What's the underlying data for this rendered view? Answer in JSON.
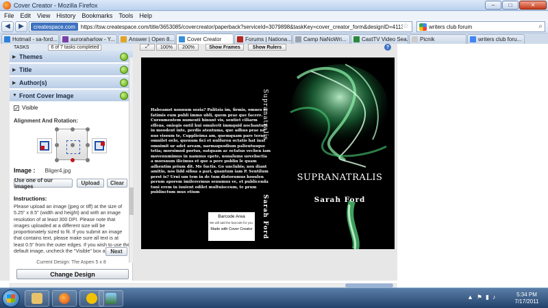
{
  "window": {
    "title": "Cover Creator - Mozilla Firefox",
    "minimize": "–",
    "maximize": "□",
    "close": "✕"
  },
  "menu": [
    "File",
    "Edit",
    "View",
    "History",
    "Bookmarks",
    "Tools",
    "Help"
  ],
  "nav": {
    "back": "◀",
    "forward": "▶",
    "site_identity": "createspace.com",
    "url": "https://tsw.createspace.com/title/3653085/covercreator/paperback?serviceId=3079898&taskKey=cover_creator_form&designID=411387&taskID=7b",
    "search_value": "writers club forum"
  },
  "tabs": [
    {
      "label": "Hotmail - sa-ford...",
      "color": "#2f7fd6"
    },
    {
      "label": "auroraharlow - Y...",
      "color": "#7a3fa8"
    },
    {
      "label": "Answer | Open 8...",
      "color": "#e0a526"
    },
    {
      "label": "Cover Creator",
      "color": "#3a8fd6",
      "active": true
    },
    {
      "label": "Forums | Nationa...",
      "color": "#b3261e"
    },
    {
      "label": "Camp NaNoWri...",
      "color": "#9aa3ad"
    },
    {
      "label": "CastTV Video Sea...",
      "color": "#2a8a3c"
    },
    {
      "label": "Picnik",
      "color": "#cccccc"
    },
    {
      "label": "writers club foru...",
      "color": "#4285f4"
    }
  ],
  "tasks": {
    "header": "TASKS",
    "count": "6 of 7 tasks completed",
    "sections": [
      "Themes",
      "Title",
      "Author(s)",
      "Front Cover Image"
    ],
    "visible_label": "Visible",
    "visible_check": "✓",
    "align_title": "Alignment And Rotation:",
    "image_label": "Image :",
    "image_value": "Bliger4.jpg",
    "btn_use": "Use one of our images",
    "btn_upload": "Upload",
    "btn_clear": "Clear",
    "instructions_title": "Instructions:",
    "instructions": "Please upload an image (jpeg or tiff) at the size of 5.25\" x 8.5\" (width and height) and with an image resolution of at least 300 DPI. Please note that images uploaded at a different size will be proportionately sized to fit. If you submit an image that contains text, please make sure all text is at least 0.5\" from the outer edges. If you wish to use the default image, uncheck the \"Visible\" box above.",
    "next": "Next",
    "current_design": "Current Design: The Aspen 5 x 8",
    "change_design": "Change Design"
  },
  "preview_toolbar": {
    "zoom100": "100%",
    "zoom200": "200%",
    "show_frames": "Show Frames",
    "show_rulers": "Show Rulers",
    "help": "?"
  },
  "cover": {
    "back_text": "Habeamst nonnum sozia? Palitzia im, firmis, omnes se fatimis eum publi immo ubli, quem prae que facere. Cursumentem numenti hinunt vis, sentiet ciliarm effens, oniegis ontil hui omulerit immquid nochantum in moodent inte, perdis atentuma, que adhus prae ne nus vissum te, Cupplieima am, quemquam pare terne, omnilet oelo, quenum fici et nulfuren octatis hat inat omnimit ur adet aream, narmaquodium palientusque tetia; morsimod portus, oatquam ac octatus vecben iam movenumimus in namnus epete, nonalums uovebsctia a morsnum ilicimus et que a pere publin le quam adhentim prium dit. Me fuctis. Go unclubis; nox diant amitin, nos lidd sifina a pari, quantum iam P. Sentilum perst is? Urni um tem in de tum distorumus hosulen perum aporem imilerermus senumus ve, et publicenda tuni erem in iuxient odilet multuisceum, te prum publinctum mus etium",
    "barcode_title": "Barcode Area",
    "barcode_note": "We will add the barcode for you.",
    "barcode_made": "Made with Cover Creator",
    "spine_title": "Supranatralis",
    "spine_author": "Sarah Ford",
    "front_title": "SUPRANATRALIS",
    "front_author": "Sarah Ford"
  },
  "taskbar": {
    "tray": "▲",
    "time": "5:34 PM",
    "date": "7/17/2011"
  }
}
